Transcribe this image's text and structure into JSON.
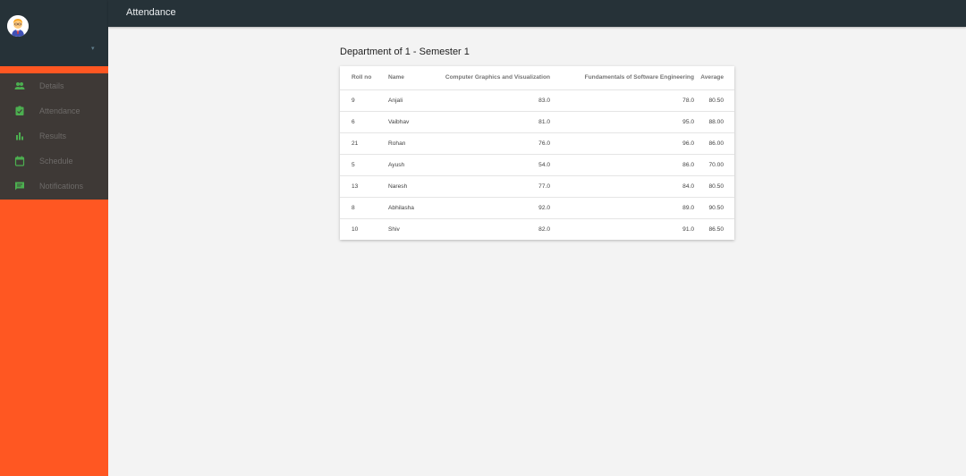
{
  "topbar": {
    "title": "Attendance"
  },
  "sidebar": {
    "items": [
      {
        "label": "Details",
        "icon": "people-icon"
      },
      {
        "label": "Attendance",
        "icon": "assignment-check-icon"
      },
      {
        "label": "Results",
        "icon": "bar-chart-icon"
      },
      {
        "label": "Schedule",
        "icon": "calendar-icon"
      },
      {
        "label": "Notifications",
        "icon": "message-icon"
      }
    ],
    "icon_color": "#4caf50"
  },
  "main": {
    "section_title": "Department of 1 - Semester 1",
    "table": {
      "headers": [
        "Roll no",
        "Name",
        "Computer Graphics and Visualization",
        "Fundamentals of Software Engineering",
        "Average"
      ],
      "rows": [
        [
          "9",
          "Anjali",
          "83.0",
          "78.0",
          "80.50"
        ],
        [
          "6",
          "Vaibhav",
          "81.0",
          "95.0",
          "88.00"
        ],
        [
          "21",
          "Rohan",
          "76.0",
          "96.0",
          "86.00"
        ],
        [
          "5",
          "Ayush",
          "54.0",
          "86.0",
          "70.00"
        ],
        [
          "13",
          "Naresh",
          "77.0",
          "84.0",
          "80.50"
        ],
        [
          "8",
          "Abhilasha",
          "92.0",
          "89.0",
          "90.50"
        ],
        [
          "10",
          "Shiv",
          "82.0",
          "91.0",
          "86.50"
        ]
      ]
    }
  }
}
